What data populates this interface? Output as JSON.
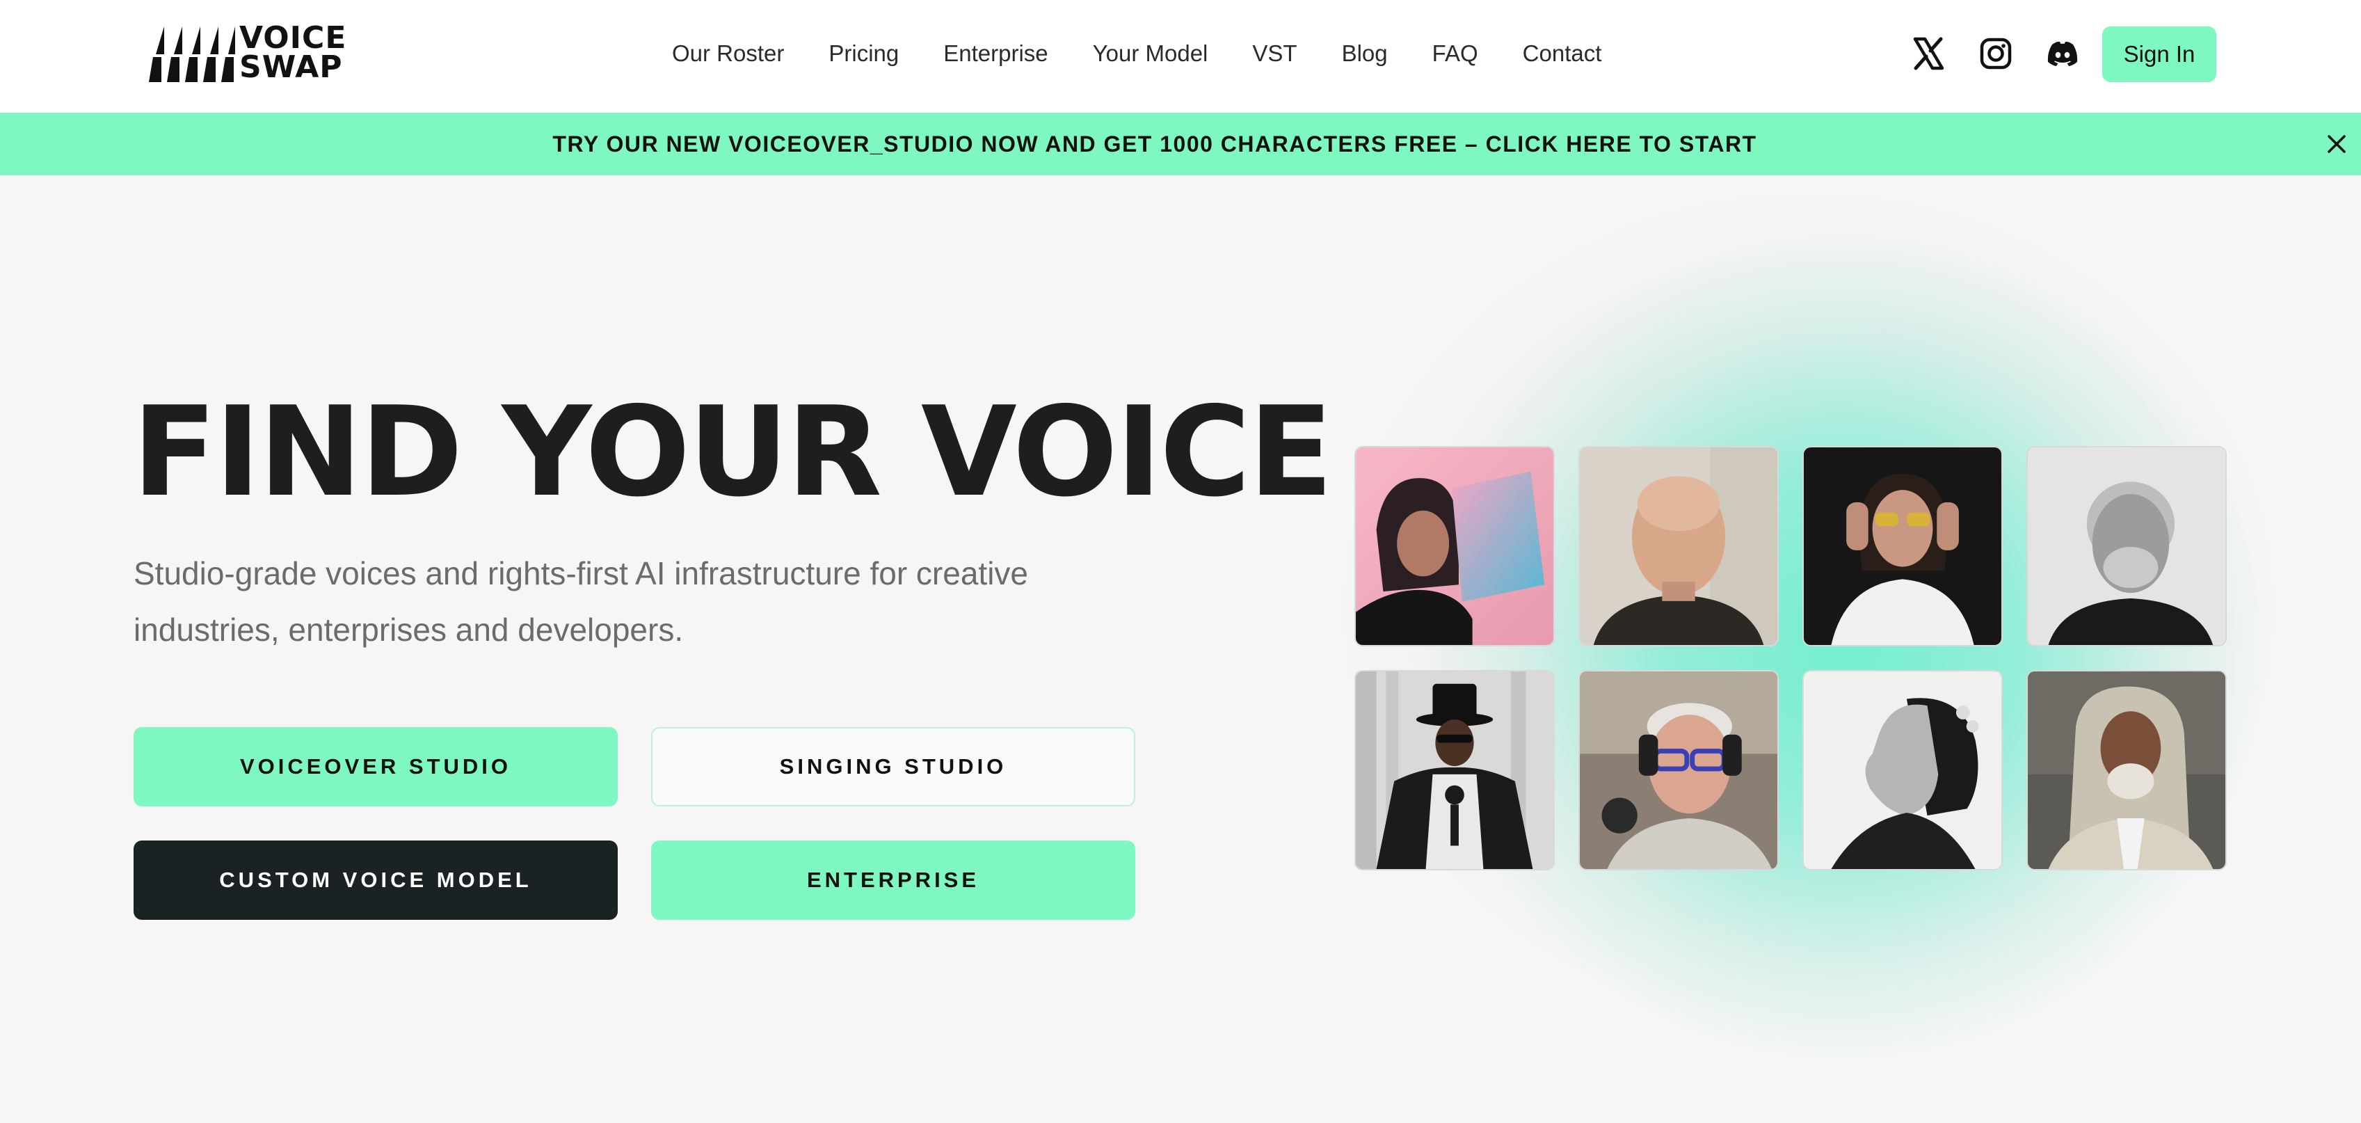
{
  "brand": {
    "line1": "VOICE",
    "line2": "SWAP"
  },
  "nav": {
    "items": [
      "Our Roster",
      "Pricing",
      "Enterprise",
      "Your Model",
      "VST",
      "Blog",
      "FAQ",
      "Contact"
    ]
  },
  "social": {
    "icons": [
      "x-icon",
      "instagram-icon",
      "discord-icon"
    ]
  },
  "header": {
    "signin_label": "Sign In"
  },
  "banner": {
    "text": "TRY OUR NEW VOICEOVER_STUDIO NOW AND GET 1000 CHARACTERS FREE – CLICK HERE TO START"
  },
  "hero": {
    "title": "FIND YOUR VOICE",
    "subtitle": "Studio-grade voices and rights-first AI infrastructure for creative industries, enterprises and developers.",
    "buttons": {
      "voiceover": "VOICEOVER STUDIO",
      "singing": "SINGING STUDIO",
      "custom": "CUSTOM VOICE MODEL",
      "enterprise": "ENTERPRISE"
    }
  },
  "colors": {
    "accent": "#7ff7c0",
    "dark": "#1b2224",
    "background": "#f6f6f6"
  }
}
